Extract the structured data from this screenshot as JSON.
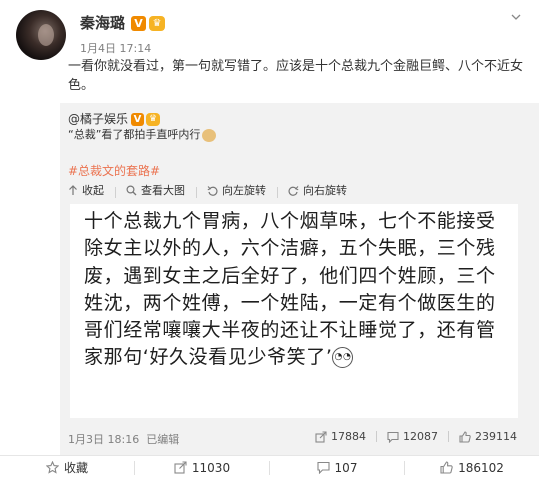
{
  "post": {
    "author": "秦海璐",
    "verified_badge": "V",
    "vip_badge": "♛",
    "date": "1月4日 17:14",
    "text": "一看你就没看过，第一句就写错了。应该是十个总裁九个金融巨鳄、八个不近女色。"
  },
  "repost": {
    "author": "@橘子娱乐",
    "verified_badge": "V",
    "vip_badge": "♛",
    "text": "“总裁”看了都拍手直呼内行",
    "hashtag": "#总裁文的套路#",
    "actions": {
      "collapse": "收起",
      "view_large": "查看大图",
      "rotate_left": "向左旋转",
      "rotate_right": "向右旋转"
    },
    "image_text": "十个总裁九个胃病，八个烟草味，七个不能接受除女主以外的人，六个洁癖，五个失眠，三个残废，遇到女主之后全好了，他们四个姓顾，三个姓沈，两个姓傅，一个姓陆，一定有个做医生的哥们经常嚷嚷大半夜的还让不让睡觉了，还有管家那句‘好久没看见少爷笑了’",
    "date": "1月3日 18:16",
    "edited": "已编辑",
    "shares": "17884",
    "comments": "12087",
    "likes": "239114"
  },
  "bottom_bar": {
    "favorite": "收藏",
    "repost": "11030",
    "comment": "107",
    "like": "186102"
  },
  "icons": {
    "chevron": "chevron-down-icon",
    "collapse": "arrow-up-icon",
    "view": "image-icon",
    "rotate_left": "rotate-left-icon",
    "rotate_right": "rotate-right-icon",
    "share": "share-icon",
    "comment": "comment-icon",
    "like": "like-icon",
    "star": "star-icon"
  },
  "colors": {
    "hashtag": "#eb7350",
    "badge": "#f08a00",
    "vip": "#f6b324",
    "repost_bg": "#f2f2f2",
    "meta": "#808080"
  }
}
